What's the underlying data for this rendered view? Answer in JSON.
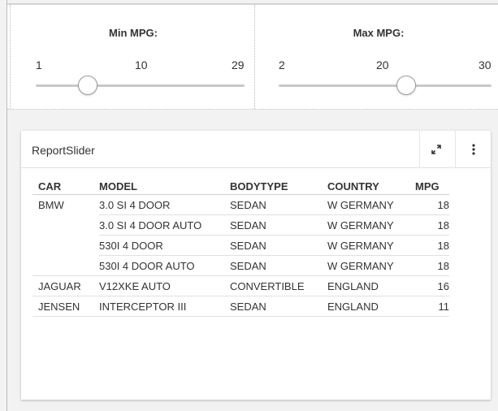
{
  "sliders": [
    {
      "title": "Min MPG:",
      "ticks": [
        "1",
        "10",
        "29"
      ],
      "value_fraction": 0.25
    },
    {
      "title": "Max MPG:",
      "ticks": [
        "2",
        "20",
        "30"
      ],
      "value_fraction": 0.6
    }
  ],
  "report": {
    "title": "ReportSlider",
    "expand_icon": "expand-arrows-icon",
    "more_icon": "vertical-ellipsis-icon",
    "columns": [
      "CAR",
      "MODEL",
      "BODYTYPE",
      "COUNTRY",
      "MPG"
    ],
    "rows": [
      {
        "car": "BMW",
        "model": "3.0 SI 4 DOOR",
        "bodytype": "SEDAN",
        "country": "W GERMANY",
        "mpg": "18"
      },
      {
        "car": "",
        "model": "3.0 SI 4 DOOR AUTO",
        "bodytype": "SEDAN",
        "country": "W GERMANY",
        "mpg": "18"
      },
      {
        "car": "",
        "model": "530I 4 DOOR",
        "bodytype": "SEDAN",
        "country": "W GERMANY",
        "mpg": "18"
      },
      {
        "car": "",
        "model": "530I 4 DOOR AUTO",
        "bodytype": "SEDAN",
        "country": "W GERMANY",
        "mpg": "18"
      },
      {
        "car": "JAGUAR",
        "model": "V12XKE AUTO",
        "bodytype": "CONVERTIBLE",
        "country": "ENGLAND",
        "mpg": "16"
      },
      {
        "car": "JENSEN",
        "model": "INTERCEPTOR III",
        "bodytype": "SEDAN",
        "country": "ENGLAND",
        "mpg": "11"
      }
    ]
  }
}
